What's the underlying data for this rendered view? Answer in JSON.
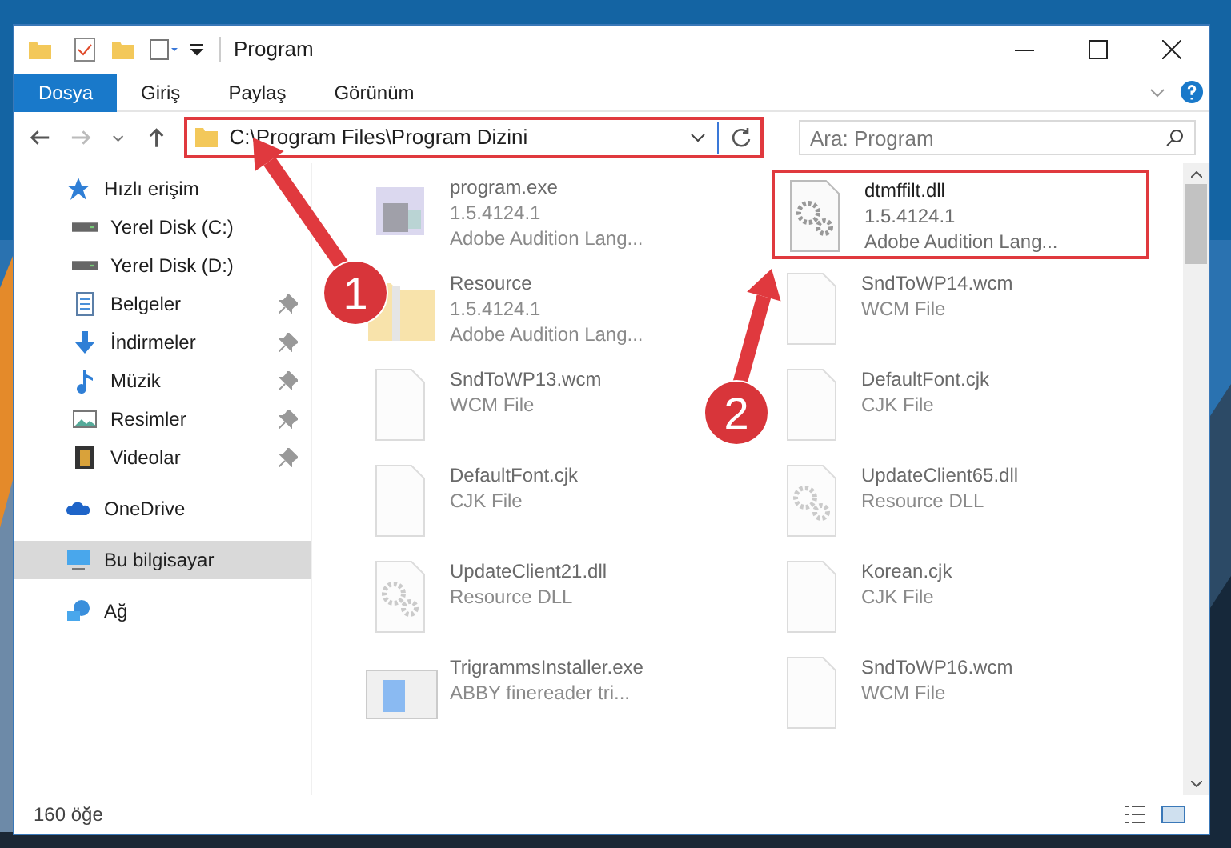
{
  "window": {
    "title": "Program"
  },
  "ribbon_tabs": [
    {
      "label": "Dosya",
      "selected": true
    },
    {
      "label": "Giriş",
      "selected": false
    },
    {
      "label": "Paylaş",
      "selected": false
    },
    {
      "label": "Görünüm",
      "selected": false
    }
  ],
  "address_bar": {
    "path": "C:\\Program Files\\Program Dizini",
    "highlighted": true
  },
  "search": {
    "placeholder": "Ara: Program"
  },
  "sidebar": {
    "items": [
      {
        "label": "Hızlı erişim",
        "kind": "star",
        "selected": false,
        "children": [
          {
            "label": "Yerel Disk (C:)",
            "kind": "drive",
            "pinned": false,
            "selected": false
          },
          {
            "label": "Yerel Disk (D:)",
            "kind": "drive",
            "pinned": false,
            "selected": false
          },
          {
            "label": "Belgeler",
            "kind": "docs",
            "pinned": true,
            "selected": false
          },
          {
            "label": "İndirmeler",
            "kind": "download",
            "pinned": true,
            "selected": false
          },
          {
            "label": "Müzik",
            "kind": "music",
            "pinned": true,
            "selected": false
          },
          {
            "label": "Resimler",
            "kind": "pictures",
            "pinned": true,
            "selected": false
          },
          {
            "label": "Videolar",
            "kind": "video",
            "pinned": true,
            "selected": false
          }
        ]
      },
      {
        "label": "OneDrive",
        "kind": "cloud",
        "selected": false
      },
      {
        "label": "Bu bilgisayar",
        "kind": "pc",
        "selected": true
      },
      {
        "label": "Ağ",
        "kind": "network",
        "selected": false
      }
    ]
  },
  "files": [
    {
      "name": "program.exe",
      "lines": [
        "1.5.4124.1",
        "Adobe Audition Lang..."
      ],
      "kind": "exe",
      "dimmed": true,
      "highlighted": false
    },
    {
      "name": "dtmffilt.dll",
      "lines": [
        "1.5.4124.1",
        "Adobe Audition Lang..."
      ],
      "kind": "dll",
      "dimmed": false,
      "highlighted": true
    },
    {
      "name": "Resource",
      "lines": [
        "1.5.4124.1",
        "Adobe Audition Lang..."
      ],
      "kind": "folder",
      "dimmed": true,
      "highlighted": false
    },
    {
      "name": "SndToWP14.wcm",
      "lines": [
        "WCM File"
      ],
      "kind": "blank",
      "dimmed": true,
      "highlighted": false
    },
    {
      "name": "SndToWP13.wcm",
      "lines": [
        "WCM File"
      ],
      "kind": "blank",
      "dimmed": true,
      "highlighted": false
    },
    {
      "name": "DefaultFont.cjk",
      "lines": [
        "CJK File"
      ],
      "kind": "blank",
      "dimmed": true,
      "highlighted": false
    },
    {
      "name": "DefaultFont.cjk",
      "lines": [
        "CJK File"
      ],
      "kind": "blank",
      "dimmed": true,
      "highlighted": false
    },
    {
      "name": "UpdateClient65.dll",
      "lines": [
        "Resource DLL"
      ],
      "kind": "dll",
      "dimmed": true,
      "highlighted": false
    },
    {
      "name": "UpdateClient21.dll",
      "lines": [
        "Resource DLL"
      ],
      "kind": "dll",
      "dimmed": true,
      "highlighted": false
    },
    {
      "name": "Korean.cjk",
      "lines": [
        "CJK File"
      ],
      "kind": "blank",
      "dimmed": true,
      "highlighted": false
    },
    {
      "name": "TrigrammsInstaller.exe",
      "lines": [
        "ABBY finereader tri..."
      ],
      "kind": "installer",
      "dimmed": true,
      "highlighted": false
    },
    {
      "name": "SndToWP16.wcm",
      "lines": [
        "WCM File"
      ],
      "kind": "blank",
      "dimmed": true,
      "highlighted": false
    }
  ],
  "status_bar": {
    "count": "160 öğe"
  },
  "annotations": [
    {
      "label": "1"
    },
    {
      "label": "2"
    }
  ]
}
